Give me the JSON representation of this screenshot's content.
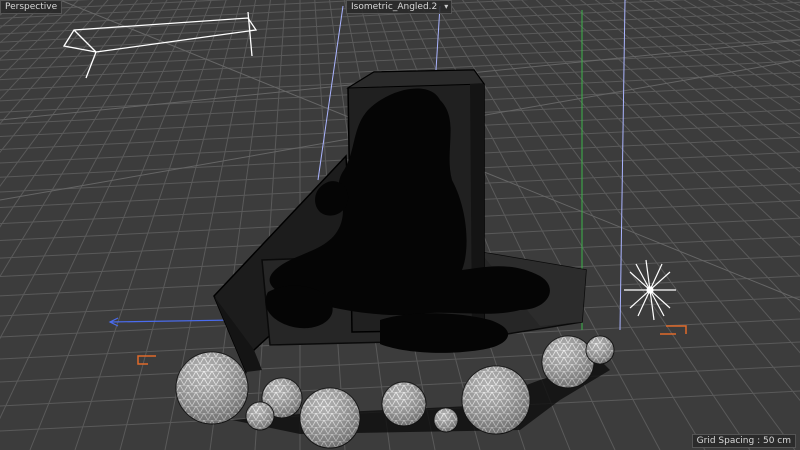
{
  "viewport": {
    "view_label": "Perspective",
    "camera_label": "Isometric_Angled.2",
    "camera_dropdown_glyph": "▾",
    "grid_spacing_label": "Grid Spacing : 50 cm"
  },
  "colors": {
    "background": "#3c3c3c",
    "grid_line": "#5a5a5a",
    "object_fill": "#1a1a1a",
    "object_edge": "#0a0a0a",
    "light_line": "#aab4ff",
    "axis_blue": "#4a6cf0",
    "axis_green": "#3db34a",
    "marker_orange": "#e06a2a",
    "sphere_wire": "#d8d8d8"
  },
  "icons": {
    "light_icon": "light-burst-icon",
    "camera_icon": "camera-wireframe-icon",
    "dropdown_icon": "chevron-down-icon"
  }
}
